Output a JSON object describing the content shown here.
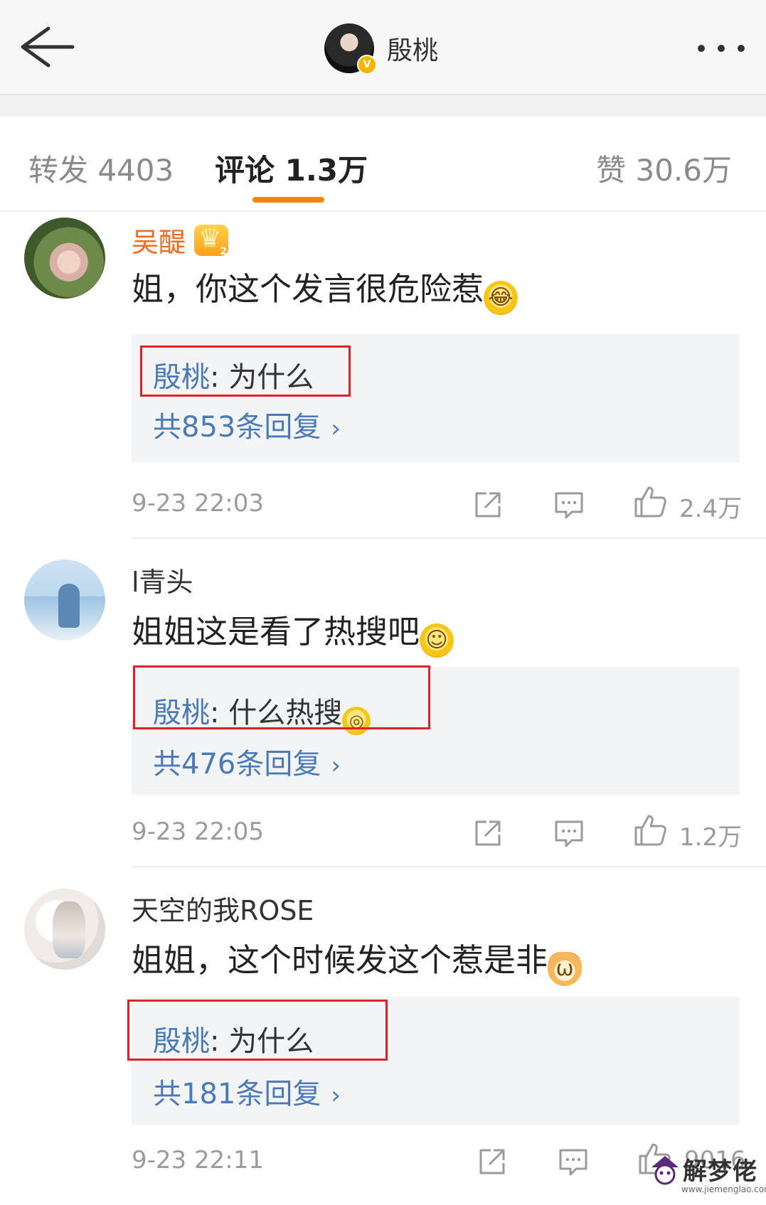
{
  "header": {
    "title": "殷桃",
    "verified_badge": "V"
  },
  "tabs": [
    {
      "label": "转发 4403"
    },
    {
      "label": "评论 1.3万"
    },
    {
      "label": "赞 30.6万"
    }
  ],
  "colors": {
    "accent": "#ff8200",
    "link": "#4a7ab8",
    "vip_name": "#f26b1d",
    "highlight_frame": "#e0202a"
  },
  "comments": [
    {
      "user": "吴醍",
      "level_badge": "2",
      "text": "姐，你这个发言很危险惹",
      "emoji": "laugh-cry-emoji",
      "reply": {
        "who": "殷桃",
        "sep": ": ",
        "text": "为什么"
      },
      "reply_count": "共853条回复",
      "time": "9-23 22:03",
      "likes": "2.4万"
    },
    {
      "user": "l青头",
      "text": "姐姐这是看了热搜吧",
      "emoji": "smile-emoji",
      "reply": {
        "who": "殷桃",
        "sep": ": ",
        "text": "什么热搜"
      },
      "reply_count": "共476条回复",
      "time": "9-23 22:05",
      "likes": "1.2万"
    },
    {
      "user": "天空的我ROSE",
      "text": "姐姐，这个时候发这个惹是非",
      "emoji": "cat-emoji",
      "reply": {
        "who": "殷桃",
        "sep": ": ",
        "text": "为什么"
      },
      "reply_count": "共181条回复",
      "time": "9-23 22:11",
      "likes": "9016"
    }
  ],
  "watermark": {
    "text": "解梦佬",
    "url": "www.jiemenglao.com"
  }
}
